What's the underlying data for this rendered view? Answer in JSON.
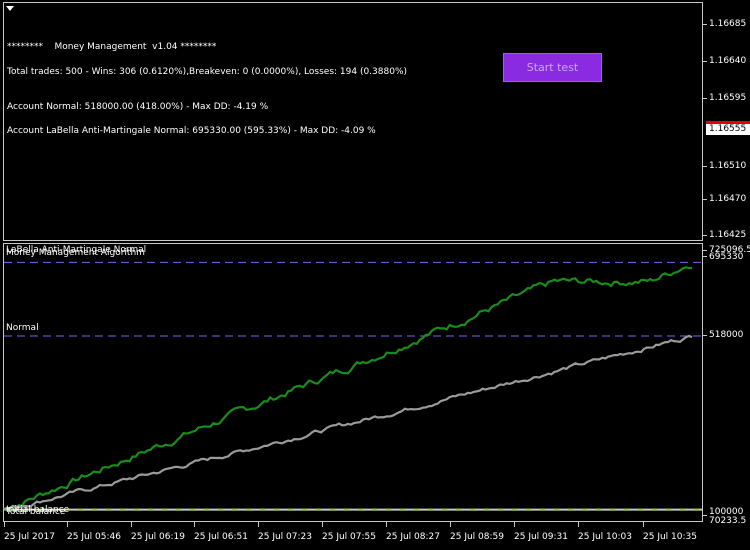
{
  "main_panel": {
    "header": "********    Money Management  v1.04 ********",
    "trades": "Total trades: 500 - Wins: 306 (0.6120%),Breakeven: 0 (0.0000%), Losses: 194 (0.3880%)",
    "account_normal": "Account Normal: 518000.00 (418.00%) - Max DD: -4.19 %",
    "account_labella": "Account LaBella Anti-Martingale Normal: 695330.00 (595.33%) - Max DD: -4.09 %",
    "start_button": "Start test",
    "price_labels": [
      "1.16685",
      "1.16640",
      "1.16595",
      "1.16510",
      "1.16470",
      "1.16425"
    ],
    "current_price": "1.16555",
    "current_price_color": "#e00000"
  },
  "sub_panel": {
    "label_labella": "LaBella Anti-Martingale Normal",
    "label_mm": "Money Management Algorithm",
    "label_normal": "Normal",
    "label_initial": "Initial balance",
    "label_total": "Total balance",
    "axis_labels": [
      "725096.5",
      "695330",
      "518000",
      "100000",
      "70233.5"
    ]
  },
  "time_axis": [
    "25 Jul 2017",
    "25 Jul 05:46",
    "25 Jul 06:19",
    "25 Jul 06:51",
    "25 Jul 07:23",
    "25 Jul 07:55",
    "25 Jul 08:27",
    "25 Jul 08:59",
    "25 Jul 09:31",
    "25 Jul 10:03",
    "25 Jul 10:35"
  ],
  "chart_data": {
    "type": "line",
    "ylim": [
      70233.5,
      725096.5
    ],
    "reference_lines": [
      695330,
      518000,
      100000
    ],
    "series": [
      {
        "name": "LaBella Anti-Martingale Normal",
        "color": "#1a8c1a",
        "start": 100000,
        "end": 695330,
        "plateau": [
          0.8,
          0.94,
          648000
        ]
      },
      {
        "name": "Normal",
        "color": "#9a9a9a",
        "start": 100000,
        "end": 518000
      }
    ]
  },
  "colors": {
    "accent": "#8a2be2",
    "green_series": "#1a8c1a",
    "gray_series": "#9a9a9a",
    "dashed_line": "#8a5cf0"
  }
}
